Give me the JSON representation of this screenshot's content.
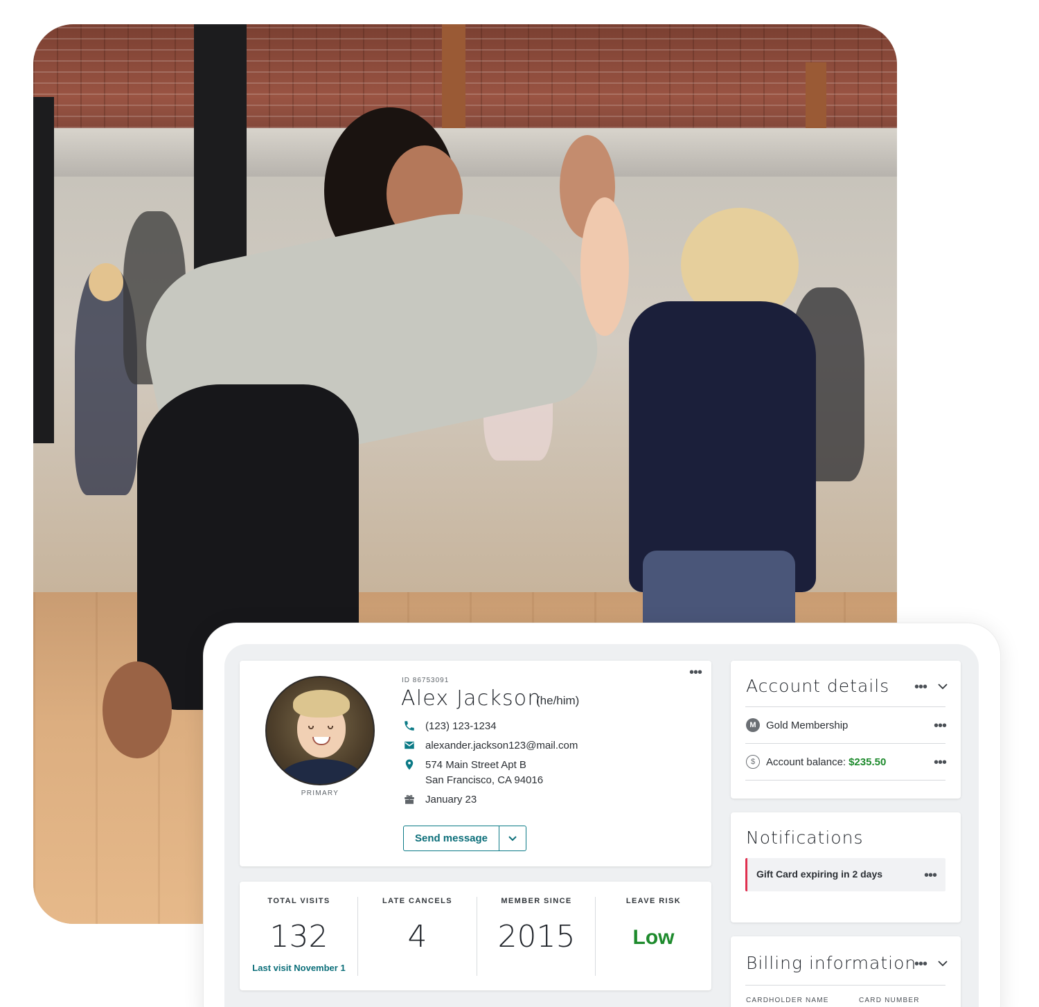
{
  "profile": {
    "id_label": "ID 86753091",
    "name": "Alex Jackson",
    "pronouns": "(he/him)",
    "avatar_caption": "PRIMARY",
    "phone": "(123) 123-1234",
    "email": "alexander.jackson123@mail.com",
    "address_line1": "574 Main Street Apt B",
    "address_line2": "San Francisco, CA 94016",
    "birthday": "January 23",
    "send_message_label": "Send message",
    "icons": [
      "phone-icon",
      "mail-icon",
      "location-pin-icon",
      "gift-icon",
      "chevron-down-icon",
      "more-dots-icon"
    ]
  },
  "stats": [
    {
      "label": "TOTAL VISITS",
      "value": "132",
      "sub": "Last visit November 1"
    },
    {
      "label": "LATE CANCELS",
      "value": "4",
      "sub": ""
    },
    {
      "label": "MEMBER SINCE",
      "value": "2015",
      "sub": ""
    },
    {
      "label": "LEAVE RISK",
      "value": "Low",
      "sub": ""
    }
  ],
  "account_details": {
    "title": "Account details",
    "membership_badge": "M",
    "membership": "Gold Membership",
    "balance_label": "Account balance:",
    "balance_value": "$235.50",
    "balance_icon": "$"
  },
  "notifications": {
    "title": "Notifications",
    "items": [
      "Gift Card expiring in 2 days"
    ]
  },
  "billing": {
    "title": "Billing information",
    "columns": [
      "CARDHOLDER NAME",
      "CARD NUMBER"
    ]
  },
  "colors": {
    "accent_teal": "#0b7a86",
    "positive_green": "#1d8a2c",
    "alert_red": "#e0304f",
    "panel_bg": "#eef0f2"
  }
}
